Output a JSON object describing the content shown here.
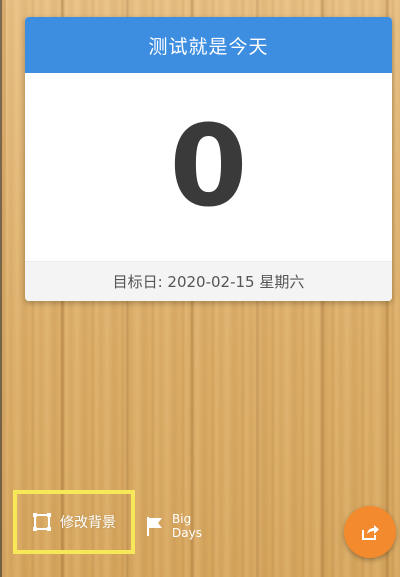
{
  "countdown": {
    "title": "测试就是今天",
    "days": "0",
    "target_date": "目标日: 2020-02-15 星期六"
  },
  "bottom_bar": {
    "change_background_label": "修改背景",
    "big_days_line1": "Big",
    "big_days_line2": "Days",
    "share_icon": "share-icon"
  },
  "colors": {
    "header_blue": "#3d8ee0",
    "fab_orange": "#f38a2d",
    "highlight_yellow": "#f7e85a"
  }
}
